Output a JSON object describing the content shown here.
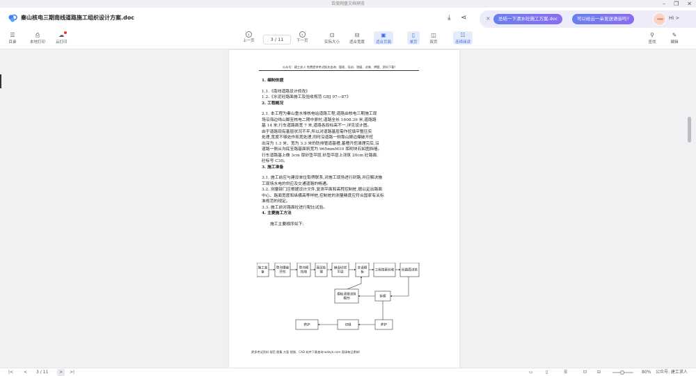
{
  "window": {
    "title": "百度网盘文档预览",
    "controls": [
      "–",
      "❐",
      "✕"
    ]
  },
  "header": {
    "logo_icon": "baidu-netdisk-logo",
    "doc_title": "秦山核电三期南线道路施工组织设计方案.doc",
    "download_icon": "download-icon",
    "share_icon": "share-icon"
  },
  "ai_bar": {
    "close": "×",
    "chip1": "总结一下清水砼施工方案.doc",
    "chip2": "可以给云一朵发送语音吗?",
    "greeting": "Hi >"
  },
  "toolbar": {
    "left": [
      {
        "icon": "toc-icon",
        "glyph": "☰",
        "label": "目录"
      },
      {
        "icon": "printer-icon",
        "glyph": "⎙",
        "label": "本地打印"
      },
      {
        "icon": "cloud-print-icon",
        "glyph": "☁",
        "label": "云打印"
      }
    ],
    "prev": {
      "glyph": "‹",
      "label": "上一页"
    },
    "page_input": "3 / 11",
    "next": {
      "glyph": "›",
      "label": "下一页"
    },
    "view": [
      {
        "glyph": "⊡",
        "label": "实际大小"
      },
      {
        "glyph": "⊟",
        "label": "适合宽度"
      },
      {
        "glyph": "▣",
        "label": "适合页面"
      },
      {
        "glyph": "▯",
        "label": "单页"
      },
      {
        "glyph": "◫",
        "label": "双页"
      },
      {
        "glyph": "☷",
        "label": "连续阅读"
      }
    ],
    "search": {
      "glyph": "⚲",
      "label": "查找"
    },
    "edit": {
      "glyph": "✎",
      "label": "编辑"
    }
  },
  "document": {
    "header_line": "公众号：建工求人 免费提供考试报名咨询、管理、培训、答疑、试卷、押题、资料下载!",
    "lines": [
      {
        "t": "1.  编制依据",
        "h": true
      },
      {
        "t": ""
      },
      {
        "t": "1.1.《南线道路设计修改》"
      },
      {
        "t": "1.2.《水泥砼路面施工及验收规范 GBJ 97—87》"
      },
      {
        "t": "2.   工程概况",
        "h": true
      },
      {
        "t": ""
      },
      {
        "t": "2.1. 本工程为秦山重水堆核电站道路工程,道路由核电三期施工现"
      },
      {
        "t": "场沿海边线山脚至核电二期中原村,道路全长 1608.39 米,道路路"
      },
      {
        "t": "基 14 米,行车道路面宽 7 米,道路各段标高不一,详见设计图。"
      },
      {
        "t": "由于道路现有基层状况不平,所以对道路基层需作挖填平整压实"
      },
      {
        "t": "处理,宽度不够处作拓宽处理,同时沿道路一侧靠山脚边爆破开挖"
      },
      {
        "t": "出深为 1.3 米、宽为 3.3 米的防排管道基槽,基槽开挖清理完后,沿"
      },
      {
        "t": "道路一侧从沟底至路基面筑宽为 965mmM10 浆砌块石如图挡墙。"
      },
      {
        "t": "行车道路基上做 3cm 厚砂垫平层,砂垫平层上浇筑 20cm 砼路面,"
      },
      {
        "t": "砼标号 C30。"
      },
      {
        "t": "3.   施工准备",
        "h": true
      },
      {
        "t": ""
      },
      {
        "t": "3.1. 施工前应与建设单位取得联系,对施工现场进行封路,并应解决施"
      },
      {
        "t": "工现场水电的供应及交通道路的畅通。"
      },
      {
        "t": "3.2. 测量部门应根据设计文件,复测平面和高程控制桩,据以定出路面"
      },
      {
        "t": "中心、路面宽度和纵横高等样桩,控制桩的测量精度应符合国家有关标"
      },
      {
        "t": "准规范的规定。"
      },
      {
        "t": "3.3. 施工前对路面砼进行配比试验。"
      },
      {
        "t": "4.   主要施工方法",
        "h": true
      },
      {
        "t": ""
      },
      {
        "t": "施工主要顺序如下:",
        "indent": true
      }
    ],
    "flow": {
      "row1": [
        "施工准备",
        "管沟爆破开挖",
        "管沟砌挡墙",
        "基层处理",
        "铺设砂找平层",
        "支设模板",
        "工程隐蔽验收",
        "砼路面浇筑"
      ],
      "row2": [
        "模板清理浇筑模剂",
        "拆模"
      ],
      "row3": [
        "养护",
        "切缝",
        "养护"
      ]
    },
    "footer_line": "更多考试资料 规范 图集 方案 视频、CAD 软件下载查询:wdzyk.com 直接每日更新!"
  },
  "statusbar": {
    "first": "|<",
    "prev": "<",
    "page": "3 / 11",
    "next": ">",
    "last": ">|",
    "zoom": "80%",
    "watermark": "公众号: 建工求人"
  }
}
